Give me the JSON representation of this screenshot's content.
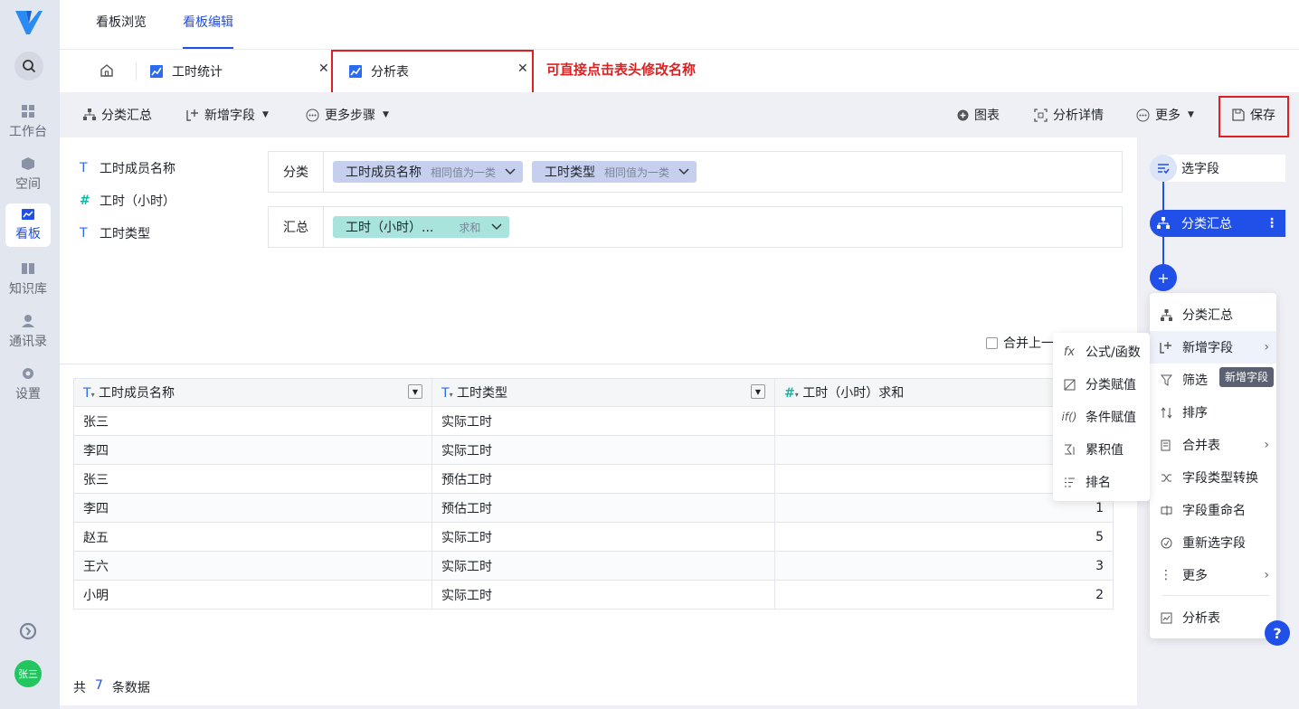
{
  "nav": {
    "items": [
      {
        "label": "工作台",
        "icon": "workbench-icon"
      },
      {
        "label": "空间",
        "icon": "space-icon"
      },
      {
        "label": "看板",
        "icon": "dashboard-icon"
      },
      {
        "label": "知识库",
        "icon": "knowledge-icon"
      },
      {
        "label": "通讯录",
        "icon": "contacts-icon"
      },
      {
        "label": "设置",
        "icon": "settings-icon"
      }
    ],
    "user_avatar": "张三"
  },
  "top_tabs": [
    "看板浏览",
    "看板编辑"
  ],
  "doc_tabs": [
    {
      "label": "工时统计"
    },
    {
      "label": "分析表"
    }
  ],
  "annotation": "可直接点击表头修改名称",
  "toolbar": {
    "group_summary": "分类汇总",
    "add_field": "新增字段",
    "more_steps": "更多步骤",
    "chart": "图表",
    "analysis_detail": "分析详情",
    "more": "更多",
    "save": "保存"
  },
  "fields": [
    {
      "type": "T",
      "name": "工时成员名称"
    },
    {
      "type": "#",
      "name": "工时（小时）"
    },
    {
      "type": "T",
      "name": "工时类型"
    }
  ],
  "config": {
    "group_label": "分类",
    "group_chips": [
      {
        "name": "工时成员名称",
        "mode": "相同值为一类"
      },
      {
        "name": "工时类型",
        "mode": "相同值为一类"
      }
    ],
    "summary_label": "汇总",
    "summary_chip": {
      "name": "工时（小时）...",
      "mode": "求和"
    },
    "merge_checkbox": "合并上一"
  },
  "table": {
    "columns": [
      {
        "type": "T",
        "name": "工时成员名称"
      },
      {
        "type": "T",
        "name": "工时类型"
      },
      {
        "type": "#",
        "name": "工时（小时）求和"
      }
    ],
    "rows": [
      [
        "张三",
        "实际工时",
        ""
      ],
      [
        "李四",
        "实际工时",
        ""
      ],
      [
        "张三",
        "预估工时",
        ""
      ],
      [
        "李四",
        "预估工时",
        "1"
      ],
      [
        "赵五",
        "实际工时",
        "5"
      ],
      [
        "王六",
        "实际工时",
        "3"
      ],
      [
        "小明",
        "实际工时",
        "2"
      ]
    ],
    "footer": {
      "prefix": "共",
      "count": "7",
      "suffix": "条数据"
    }
  },
  "steps": {
    "select_field": "选字段",
    "group_summary": "分类汇总",
    "add": "+"
  },
  "step_menu": [
    {
      "label": "分类汇总",
      "icon": "hierarchy-icon"
    },
    {
      "label": "新增字段",
      "icon": "add-field-icon",
      "submenu": true
    },
    {
      "label": "筛选",
      "icon": "filter-icon"
    },
    {
      "label": "排序",
      "icon": "sort-icon"
    },
    {
      "label": "合并表",
      "icon": "merge-table-icon",
      "submenu": true
    },
    {
      "label": "字段类型转换",
      "icon": "shuffle-icon"
    },
    {
      "label": "字段重命名",
      "icon": "rename-icon"
    },
    {
      "label": "重新选字段",
      "icon": "reselect-icon"
    },
    {
      "label": "更多",
      "icon": "more-vertical-icon",
      "submenu": true
    },
    {
      "label": "分析表",
      "icon": "analysis-table-icon"
    }
  ],
  "tooltip": "新增字段",
  "submenu": [
    {
      "label": "公式/函数",
      "icon": "fx-icon"
    },
    {
      "label": "分类赋值",
      "icon": "category-assign-icon"
    },
    {
      "label": "条件赋值",
      "icon": "condition-assign-icon"
    },
    {
      "label": "累积值",
      "icon": "cumulative-icon"
    },
    {
      "label": "排名",
      "icon": "rank-icon"
    }
  ],
  "help": "?"
}
